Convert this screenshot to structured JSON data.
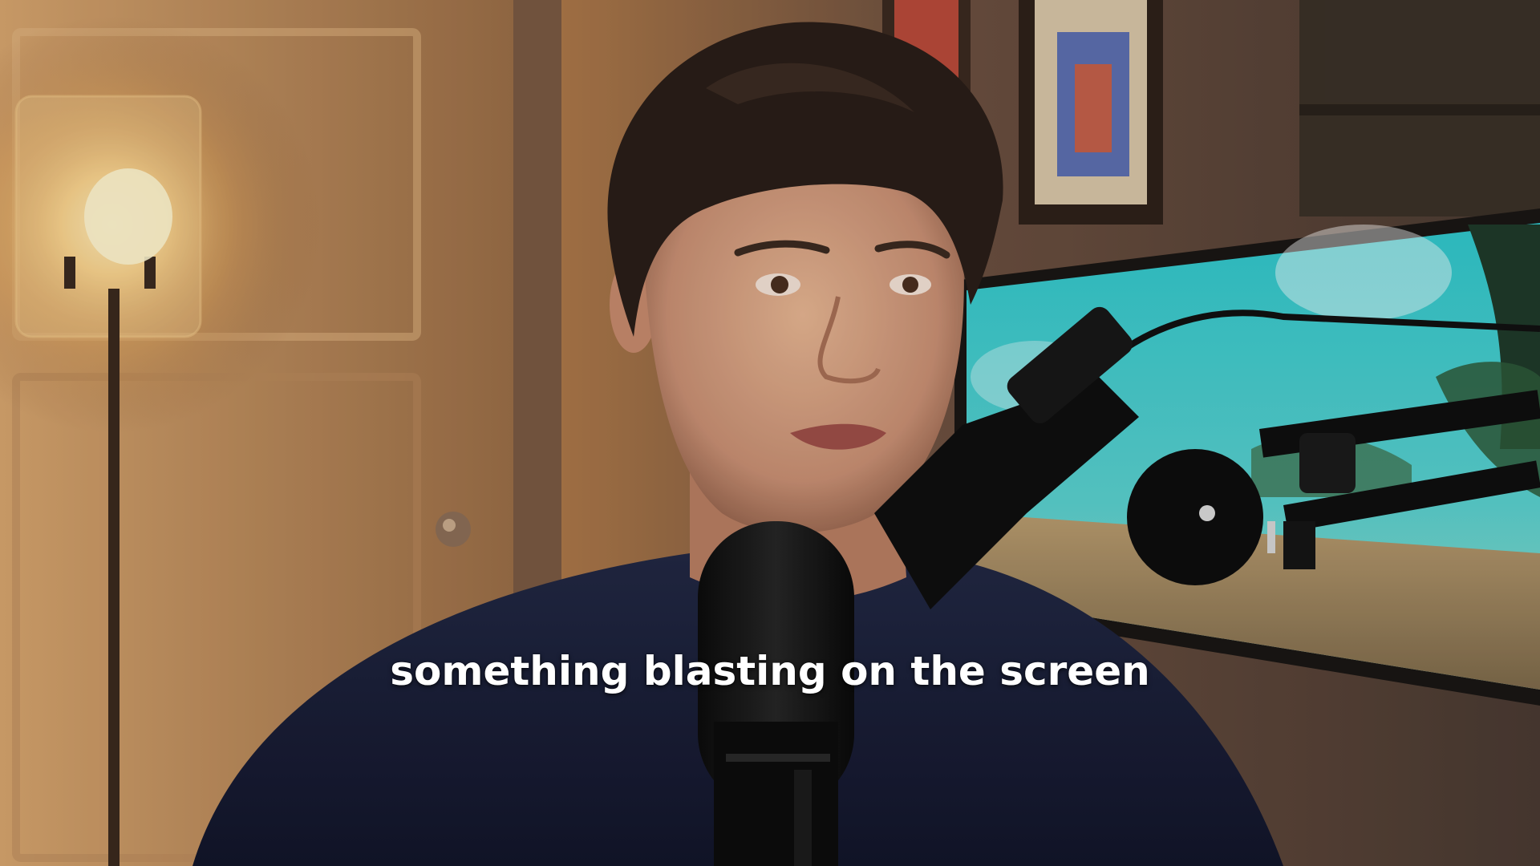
{
  "video": {
    "subtitle": "something blasting on the screen"
  },
  "scene": {
    "subject": "man-speaking-into-microphone",
    "colors": {
      "wall_warm": "#b8834f",
      "wall_shadow": "#5b3f2c",
      "lamp_glow": "#ffd68a",
      "monitor_sky": "#35c7c9",
      "shirt": "#1b1f33",
      "hair": "#2a1e18",
      "skin": "#d9a583",
      "mic": "#151515"
    }
  }
}
